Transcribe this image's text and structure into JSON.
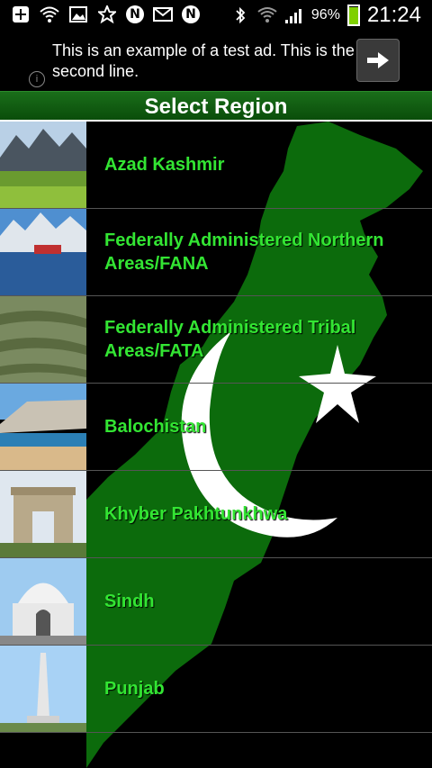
{
  "status_bar": {
    "battery_pct": "96%",
    "time": "21:24",
    "battery_level": 0.96,
    "icons": [
      "plus-icon",
      "wifi-icon",
      "picture-icon",
      "star-icon",
      "n-app-icon",
      "gmail-icon",
      "n-app-icon",
      "bluetooth-icon",
      "wifi-signal-icon",
      "cell-signal-icon",
      "battery-icon"
    ]
  },
  "ad": {
    "text": "This is an example of a test ad. This is the second line."
  },
  "header": {
    "title": "Select Region"
  },
  "regions": [
    {
      "label": "Azad Kashmir"
    },
    {
      "label": "Federally Administered Northern Areas/FANA"
    },
    {
      "label": "Federally Administered Tribal Areas/FATA"
    },
    {
      "label": "Balochistan"
    },
    {
      "label": "Khyber Pakhtunkhwa"
    },
    {
      "label": "Sindh"
    },
    {
      "label": "Punjab"
    }
  ],
  "colors": {
    "label_green": "#33e533",
    "flag_green": "#0c6b0c",
    "header_green": "#1a6e1a"
  }
}
